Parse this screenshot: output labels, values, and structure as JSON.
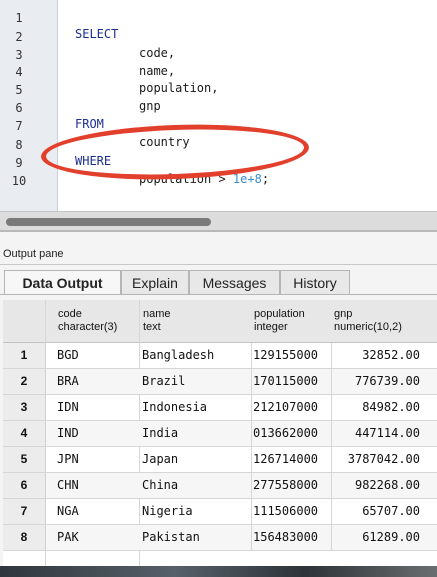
{
  "editor": {
    "lines": [
      {
        "n": "1",
        "text": "SELECT",
        "kind": "kw"
      },
      {
        "n": "2",
        "text": "code,",
        "kind": "id"
      },
      {
        "n": "3",
        "text": "name,",
        "kind": "id"
      },
      {
        "n": "4",
        "text": "population,",
        "kind": "id"
      },
      {
        "n": "5",
        "text": "gnp",
        "kind": "id"
      },
      {
        "n": "6",
        "text": "FROM",
        "kind": "kw"
      },
      {
        "n": "7",
        "text": "country",
        "kind": "id"
      },
      {
        "n": "8",
        "text": "WHERE",
        "kind": "kw"
      },
      {
        "n": "9",
        "text_a": "population > ",
        "text_num": "1e+8",
        "text_b": ";",
        "kind": "cond"
      },
      {
        "n": "10",
        "text": "",
        "kind": "id"
      }
    ]
  },
  "output": {
    "pane_title": "Output pane",
    "tabs": [
      "Data Output",
      "Explain",
      "Messages",
      "History"
    ],
    "active_tab": "Data Output",
    "columns": [
      {
        "name": "code",
        "type": "character(3)"
      },
      {
        "name": "name",
        "type": "text"
      },
      {
        "name": "population",
        "type": "integer"
      },
      {
        "name": "gnp",
        "type": "numeric(10,2)"
      }
    ],
    "rows": [
      {
        "idx": "1",
        "code": "BGD",
        "name": "Bangladesh",
        "population": "129155000",
        "gnp": "32852.00"
      },
      {
        "idx": "2",
        "code": "BRA",
        "name": "Brazil",
        "population": "170115000",
        "gnp": "776739.00"
      },
      {
        "idx": "3",
        "code": "IDN",
        "name": "Indonesia",
        "population": "212107000",
        "gnp": "84982.00"
      },
      {
        "idx": "4",
        "code": "IND",
        "name": "India",
        "population": "013662000",
        "gnp": "447114.00"
      },
      {
        "idx": "5",
        "code": "JPN",
        "name": "Japan",
        "population": "126714000",
        "gnp": "3787042.00"
      },
      {
        "idx": "6",
        "code": "CHN",
        "name": "China",
        "population": "277558000",
        "gnp": "982268.00"
      },
      {
        "idx": "7",
        "code": "NGA",
        "name": "Nigeria",
        "population": "111506000",
        "gnp": "65707.00"
      },
      {
        "idx": "8",
        "code": "PAK",
        "name": "Pakistan",
        "population": "156483000",
        "gnp": "61289.00"
      }
    ]
  },
  "colors": {
    "keyword": "#1b2f8f",
    "number": "#3a8fd0",
    "highlight": "#e2402c"
  }
}
